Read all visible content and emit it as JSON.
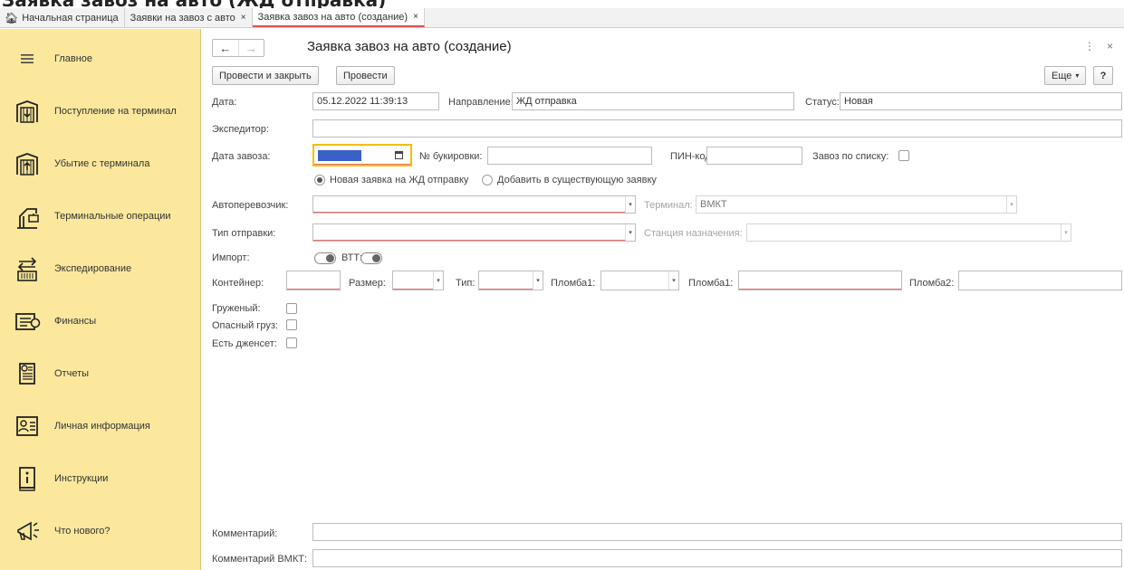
{
  "page": {
    "heading": "Заявка завоз на авто (ЖД отправка)"
  },
  "tabs": [
    {
      "label": "Начальная страница",
      "icon": "home-icon",
      "closable": false
    },
    {
      "label": "Заявки на завоз с авто",
      "closable": true
    },
    {
      "label": "Заявка завоз на авто (создание)",
      "closable": true,
      "active": true
    }
  ],
  "tab_close": "×",
  "sidebar": {
    "items": [
      {
        "label": "Главное",
        "icon": "menu-icon"
      },
      {
        "label": "Поступление на терминал",
        "icon": "terminal-in-icon"
      },
      {
        "label": "Убытие с терминала",
        "icon": "terminal-out-icon"
      },
      {
        "label": "Терминальные операции",
        "icon": "crane-icon"
      },
      {
        "label": "Экспедирование",
        "icon": "forwarding-icon"
      },
      {
        "label": "Финансы",
        "icon": "finance-icon"
      },
      {
        "label": "Отчеты",
        "icon": "reports-icon"
      },
      {
        "label": "Личная информация",
        "icon": "profile-icon"
      },
      {
        "label": "Инструкции",
        "icon": "instructions-icon"
      },
      {
        "label": "Что нового?",
        "icon": "megaphone-icon"
      }
    ]
  },
  "form": {
    "back": "←",
    "forward": "→",
    "title": "Заявка завоз на авто (создание)",
    "more_icon": "⋮",
    "close_icon": "×",
    "buttons": {
      "post_close": "Провести и закрыть",
      "post": "Провести",
      "more": "Еще",
      "more_arrow": "▾",
      "help": "?"
    },
    "labels": {
      "date": "Дата:",
      "direction": "Направление:",
      "status": "Статус:",
      "forwarder": "Экспедитор:",
      "delivery_date": "Дата завоза:",
      "booking": "№ букировки:",
      "pin": "ПИН-код:",
      "by_list": "Завоз по списку:",
      "new_request": "Новая заявка на ЖД отправку",
      "add_existing": "Добавить в существующую заявку",
      "carrier": "Автоперевозчик:",
      "terminal": "Терминал:",
      "shipment_type": "Тип отправки:",
      "dest_station": "Станция назначения:",
      "import": "Импорт:",
      "vtt": "ВТТ:",
      "container": "Контейнер:",
      "size": "Размер:",
      "type": "Тип:",
      "seal1a": "Пломба1:",
      "seal1b": "Пломба1:",
      "seal2": "Пломба2:",
      "loaded": "Груженый:",
      "dangerous": "Опасный груз:",
      "gen_set": "Есть дженсет:",
      "comment": "Комментарий:",
      "comment_vmkt": "Комментарий ВМКТ:"
    },
    "values": {
      "date": "05.12.2022 11:39:13",
      "direction": "ЖД отправка",
      "status": "Новая",
      "forwarder": "",
      "delivery_date": "",
      "booking": "",
      "pin": "",
      "carrier": "",
      "terminal": "ВМКТ",
      "shipment_type": "",
      "dest_station": "",
      "container": "",
      "size": "",
      "type": "",
      "seal1a": "",
      "seal1b": "",
      "seal2": "",
      "comment": "",
      "comment_vmkt": ""
    },
    "icons": {
      "calendar": "calendar-icon",
      "dropdown": "▾"
    }
  }
}
